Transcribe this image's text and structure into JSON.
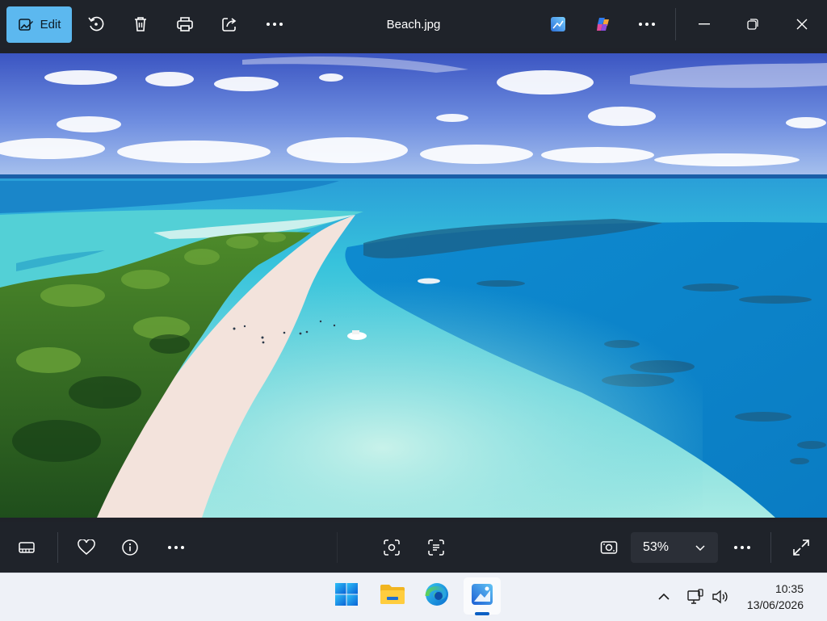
{
  "toolbar": {
    "edit_label": "Edit",
    "file_name": "Beach.jpg",
    "icons": [
      "edit-image-icon",
      "rotate-icon",
      "delete-icon",
      "print-icon",
      "share-icon",
      "more-icon",
      "designer-icon",
      "copilot-icon",
      "more-icon",
      "minimize-icon",
      "restore-icon",
      "close-icon"
    ]
  },
  "bottom_bar": {
    "zoom_value": "53%",
    "icons": [
      "filmstrip-icon",
      "favorite-icon",
      "info-icon",
      "more-icon",
      "visual-search-icon",
      "text-scan-icon",
      "actual-size-icon",
      "more-icon",
      "full-screen-icon"
    ]
  },
  "taskbar": {
    "apps": [
      "Start",
      "File Explorer",
      "Microsoft Edge",
      "Photos"
    ],
    "active_app": "Photos",
    "time": "10:35",
    "date": "13/06/2026"
  },
  "colors": {
    "accent": "#5cb8ef",
    "toolbar_bg": "#1f232a",
    "taskbar_bg": "#eef1f7",
    "indicator": "#0a5fc4"
  }
}
